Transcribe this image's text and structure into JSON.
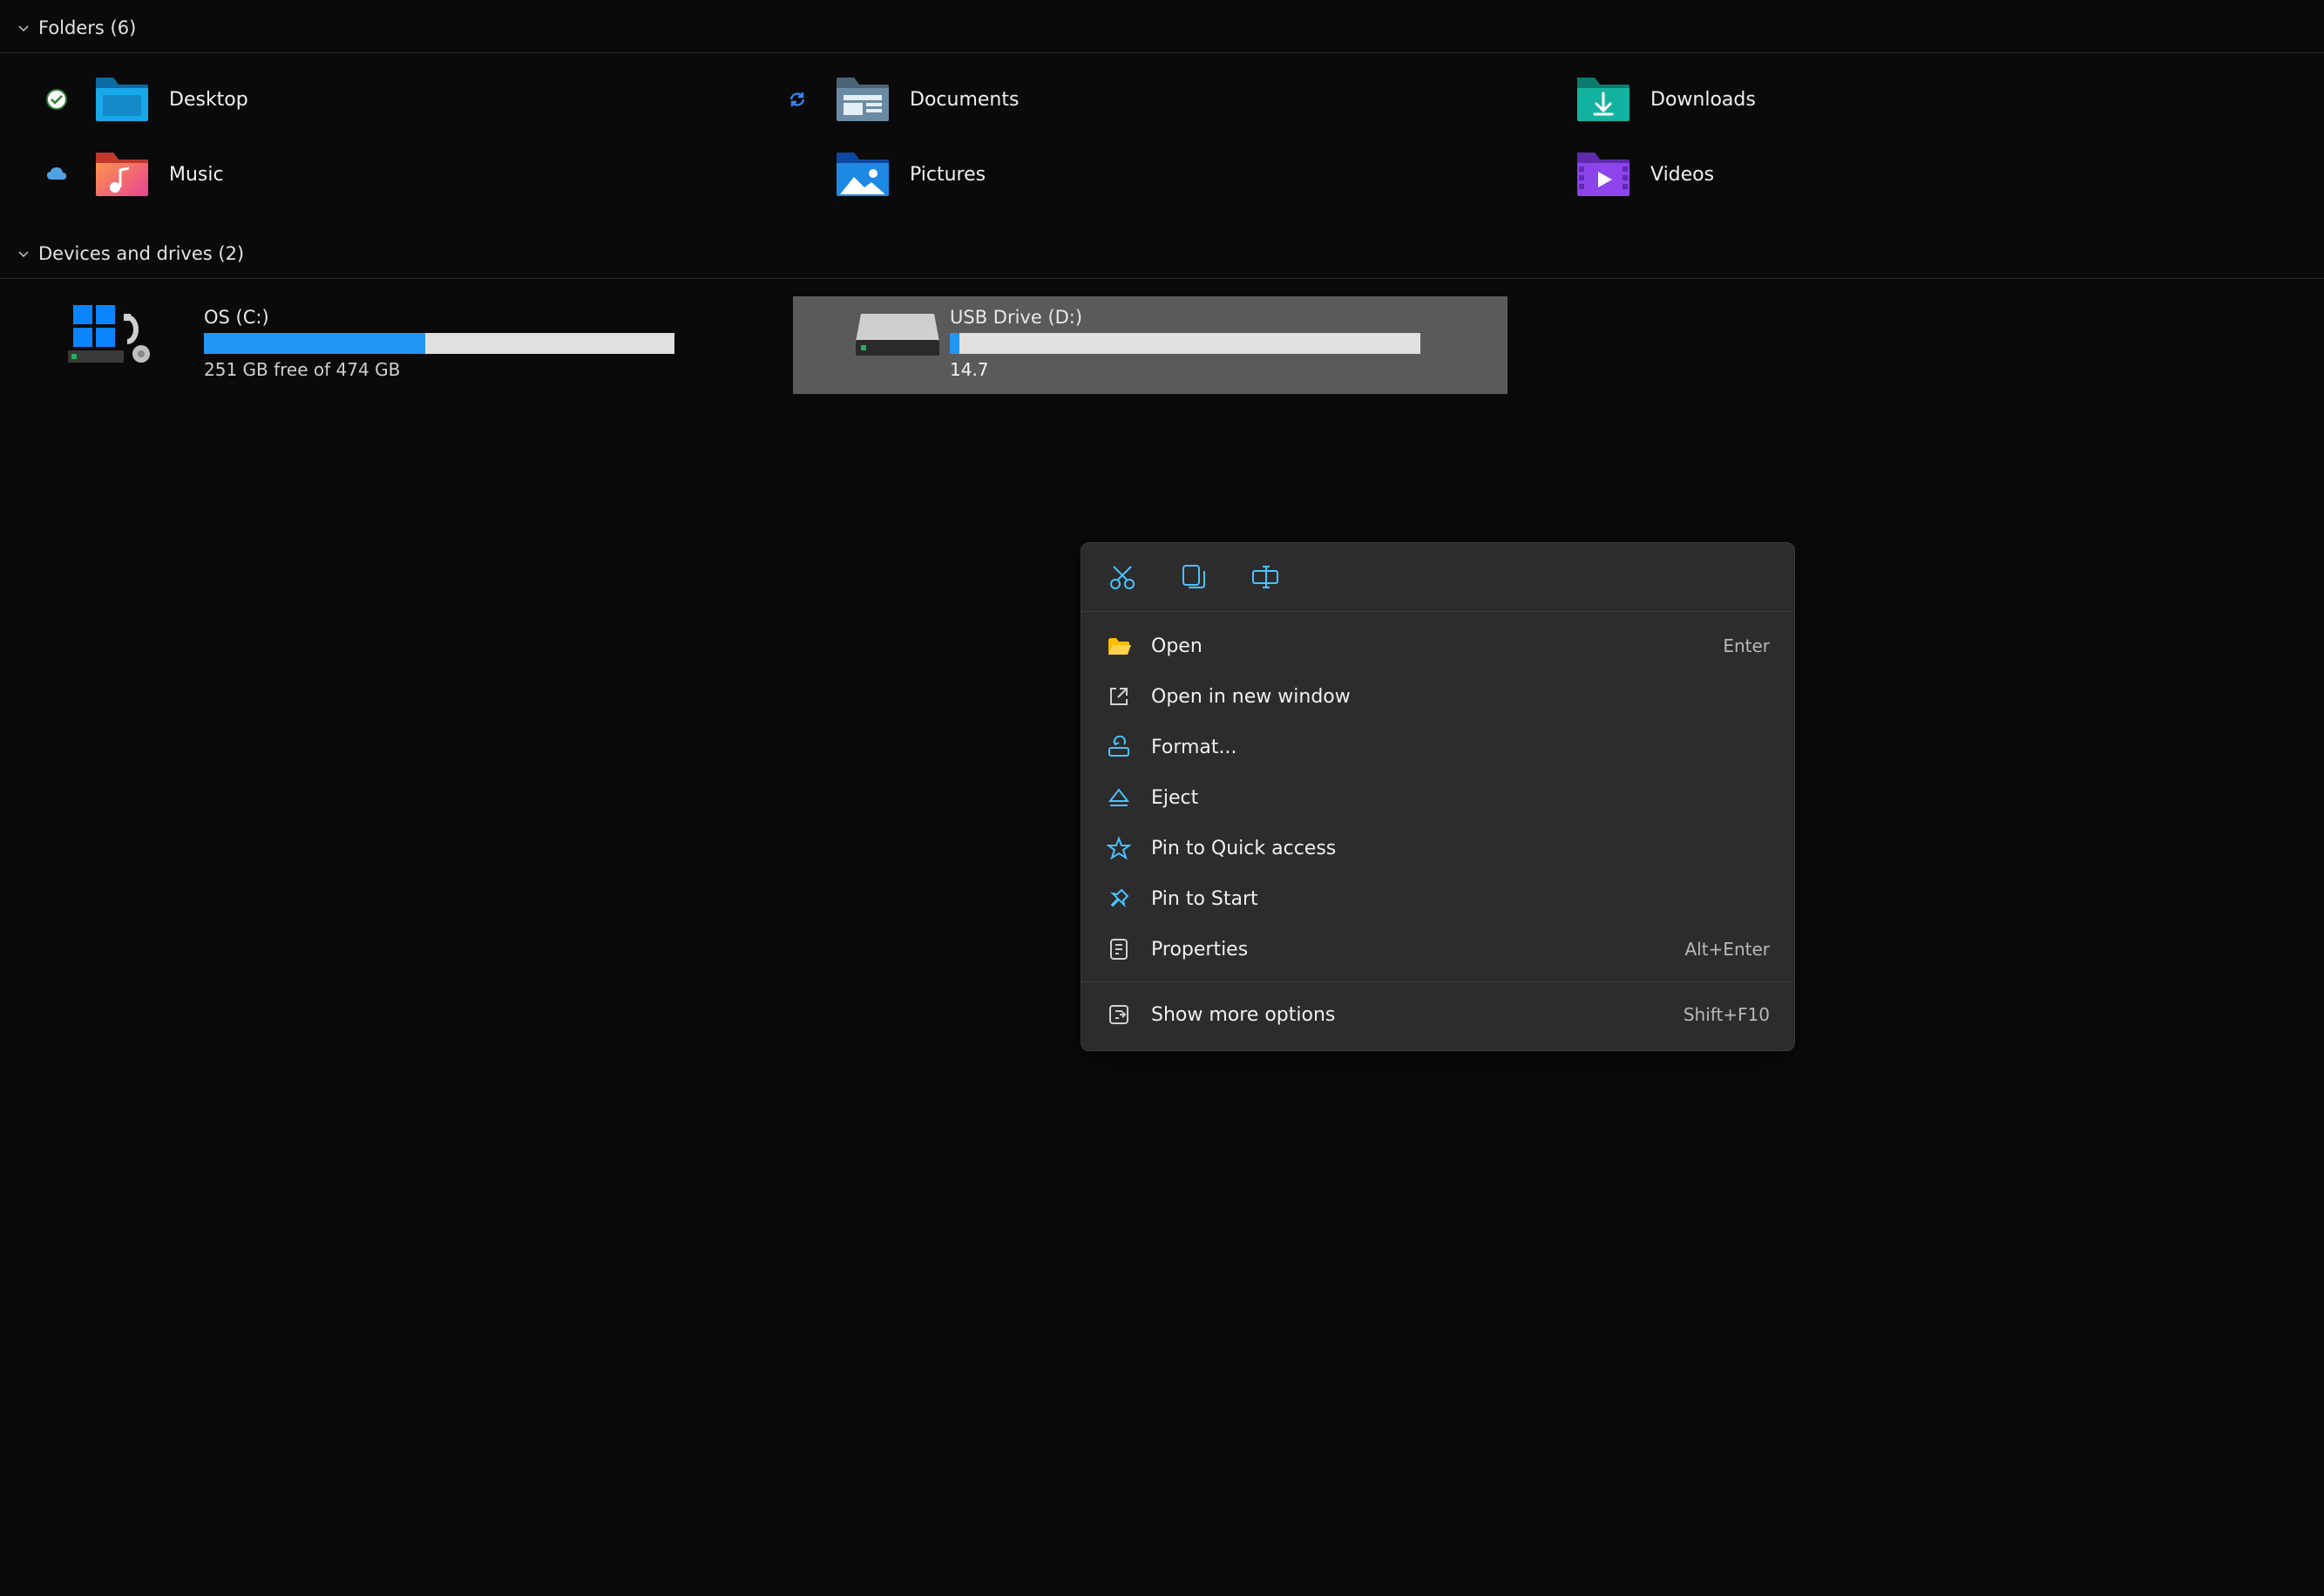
{
  "sections": {
    "folders": {
      "title": "Folders (6)",
      "items": [
        {
          "label": "Desktop"
        },
        {
          "label": "Documents"
        },
        {
          "label": "Downloads"
        },
        {
          "label": "Music"
        },
        {
          "label": "Pictures"
        },
        {
          "label": "Videos"
        }
      ]
    },
    "drives": {
      "title": "Devices and drives (2)",
      "items": [
        {
          "name": "OS (C:)",
          "free_text": "251 GB free of 474 GB",
          "used_percent": 47
        },
        {
          "name": "USB Drive (D:)",
          "free_text": "14.7",
          "used_percent": 2
        }
      ]
    }
  },
  "context_menu": {
    "top_actions": [
      "cut",
      "copy",
      "rename"
    ],
    "items": [
      {
        "icon": "folder-open",
        "label": "Open",
        "shortcut": "Enter"
      },
      {
        "icon": "external",
        "label": "Open in new window",
        "shortcut": ""
      },
      {
        "icon": "format",
        "label": "Format...",
        "shortcut": ""
      },
      {
        "icon": "eject",
        "label": "Eject",
        "shortcut": ""
      },
      {
        "icon": "star",
        "label": "Pin to Quick access",
        "shortcut": ""
      },
      {
        "icon": "pin",
        "label": "Pin to Start",
        "shortcut": ""
      },
      {
        "icon": "properties",
        "label": "Properties",
        "shortcut": "Alt+Enter"
      }
    ],
    "more": {
      "label": "Show more options",
      "shortcut": "Shift+F10"
    }
  },
  "colors": {
    "accent": "#4cc2ff",
    "progress": "#2196f3"
  }
}
